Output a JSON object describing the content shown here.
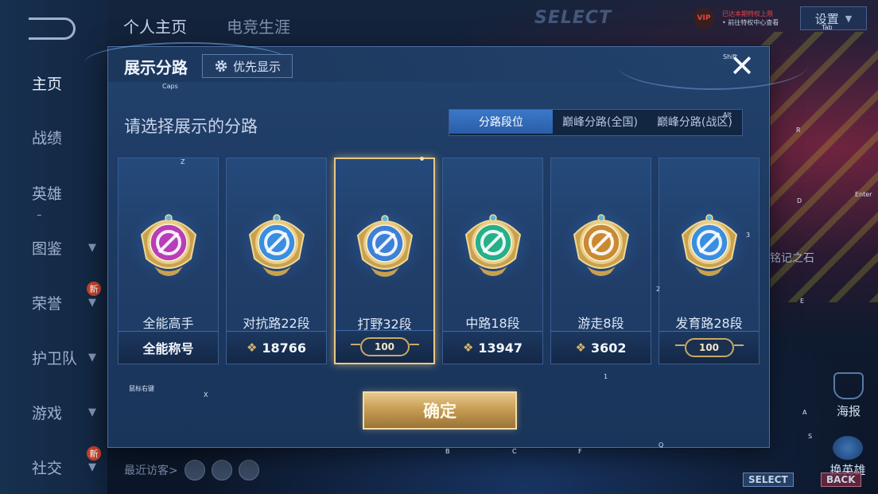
{
  "background": {
    "tabs": [
      "个人主页",
      "电竞生涯"
    ],
    "nav": [
      {
        "label": "主页",
        "chevron": false,
        "new": false
      },
      {
        "label": "战绩",
        "chevron": false,
        "new": false
      },
      {
        "label": "英雄",
        "chevron": false,
        "new": false
      },
      {
        "label": "图鉴",
        "chevron": true,
        "new": false
      },
      {
        "label": "荣誉",
        "chevron": true,
        "new": true
      },
      {
        "label": "护卫队",
        "chevron": true,
        "new": false
      },
      {
        "label": "游戏",
        "chevron": true,
        "new": false
      },
      {
        "label": "社交",
        "chevron": true,
        "new": true
      }
    ],
    "new_badge": "新",
    "vip_label": "VIP",
    "vip_info_1": "已达本期特权上限",
    "vip_info_2": "• 前往特权中心查看",
    "settings_label": "设置",
    "select_title": "SELECT",
    "recent_visitors": "最近访客>",
    "stone_label": "铭记之石",
    "poster_label": "海报",
    "switch_hero_label": "换英雄",
    "hint_select": "SELECT",
    "hint_back": "BACK"
  },
  "key_hints": {
    "caps": "Caps",
    "shift": "Shift",
    "tab": "Tab",
    "alt": "Alt",
    "enter": "Enter",
    "z": "Z",
    "x": "X",
    "r": "R",
    "d": "D",
    "e": "E",
    "three": "3",
    "two": "2",
    "one": "1",
    "a": "A",
    "s": "S",
    "b": "B",
    "c": "C",
    "f": "F",
    "q": "Q",
    "tilde": "~",
    "mouse_right": "鼠标右键"
  },
  "dialog": {
    "title": "展示分路",
    "priority_button": "优先显示",
    "subtitle": "请选择展示的分路",
    "tabs": [
      {
        "label": "分路段位",
        "active": true
      },
      {
        "label": "巅峰分路(全国)",
        "active": false
      },
      {
        "label": "巅峰分路(战区)",
        "active": false
      }
    ],
    "cards": [
      {
        "name": "全能高手",
        "footer_type": "text",
        "footer": "全能称号",
        "emblem_color": "#b83db8",
        "selected": false
      },
      {
        "name": "对抗路22段",
        "footer_type": "points",
        "footer": "18766",
        "emblem_color": "#3a8ee0",
        "selected": false
      },
      {
        "name": "打野32段",
        "footer_type": "rank",
        "footer": "100",
        "emblem_color": "#3d80d8",
        "selected": true
      },
      {
        "name": "中路18段",
        "footer_type": "points",
        "footer": "13947",
        "emblem_color": "#25b08a",
        "selected": false
      },
      {
        "name": "游走8段",
        "footer_type": "points",
        "footer": "3602",
        "emblem_color": "#c98a34",
        "selected": false
      },
      {
        "name": "发育路28段",
        "footer_type": "rank",
        "footer": "100",
        "emblem_color": "#3a8ee0",
        "selected": false
      }
    ],
    "confirm_button": "确定"
  },
  "colors": {
    "accent_gold": "#e9c987",
    "active_tab": "#3b78c9",
    "dialog_bg": "#1d3a62"
  }
}
